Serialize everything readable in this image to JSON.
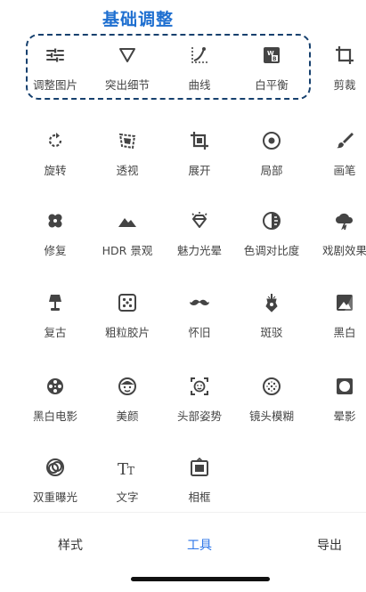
{
  "annotation": {
    "title": "基础调整"
  },
  "tools": [
    {
      "id": "adjust",
      "label": "调整图片",
      "icon": "sliders-icon"
    },
    {
      "id": "selective",
      "label": "突出细节",
      "icon": "triangle-down-icon"
    },
    {
      "id": "curves",
      "label": "曲线",
      "icon": "curve-icon"
    },
    {
      "id": "wb",
      "label": "白平衡",
      "icon": "white-balance-icon"
    },
    {
      "id": "crop",
      "label": "剪裁",
      "icon": "crop-icon"
    },
    {
      "id": "rotate",
      "label": "旋转",
      "icon": "rotate-icon"
    },
    {
      "id": "perspective",
      "label": "透视",
      "icon": "perspective-icon"
    },
    {
      "id": "expand",
      "label": "展开",
      "icon": "expand-icon"
    },
    {
      "id": "brush-local",
      "label": "局部",
      "icon": "target-icon"
    },
    {
      "id": "brush",
      "label": "画笔",
      "icon": "brush-icon"
    },
    {
      "id": "healing",
      "label": "修复",
      "icon": "bandage-icon"
    },
    {
      "id": "hdr",
      "label": "HDR 景观",
      "icon": "mountain-icon"
    },
    {
      "id": "glamour",
      "label": "魅力光晕",
      "icon": "diamond-icon"
    },
    {
      "id": "tonal",
      "label": "色调对比度",
      "icon": "tonal-contrast-icon"
    },
    {
      "id": "drama",
      "label": "戏剧效果",
      "icon": "cloud-bolt-icon"
    },
    {
      "id": "vintage",
      "label": "复古",
      "icon": "lamp-icon"
    },
    {
      "id": "grainy",
      "label": "粗粒胶片",
      "icon": "dice-icon"
    },
    {
      "id": "retrolux",
      "label": "怀旧",
      "icon": "mustache-icon"
    },
    {
      "id": "grunge",
      "label": "斑驳",
      "icon": "guitar-icon"
    },
    {
      "id": "bw",
      "label": "黑白",
      "icon": "bw-photo-icon"
    },
    {
      "id": "noir",
      "label": "黑白电影",
      "icon": "film-reel-icon"
    },
    {
      "id": "face",
      "label": "美颜",
      "icon": "face-icon"
    },
    {
      "id": "headpose",
      "label": "头部姿势",
      "icon": "face-frame-icon"
    },
    {
      "id": "lensblur",
      "label": "镜头模糊",
      "icon": "blur-icon"
    },
    {
      "id": "vignette",
      "label": "晕影",
      "icon": "vignette-icon"
    },
    {
      "id": "double",
      "label": "双重曝光",
      "icon": "double-circle-icon"
    },
    {
      "id": "text",
      "label": "文字",
      "icon": "text-icon"
    },
    {
      "id": "frames",
      "label": "相框",
      "icon": "frame-icon"
    }
  ],
  "tabs": [
    {
      "label": "样式",
      "active": false
    },
    {
      "label": "工具",
      "active": true
    },
    {
      "label": "导出",
      "active": false
    }
  ],
  "colors": {
    "accent": "#2d76e8",
    "annotation": "#1e6fd0",
    "icon": "#444444"
  }
}
